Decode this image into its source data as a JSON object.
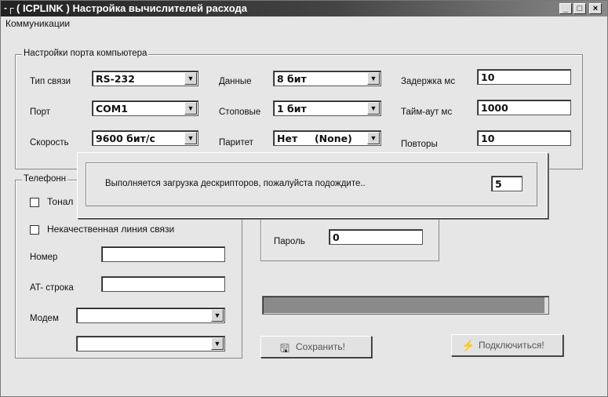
{
  "window": {
    "title": "( ICPLINK ) Настройка вычислителей расхода",
    "system_icon": "-┌",
    "min_glyph": "_",
    "max_glyph": "□",
    "close_glyph": "×"
  },
  "menu": {
    "items": [
      {
        "label": "Коммуникации"
      }
    ]
  },
  "port_settings": {
    "title": "Настройки порта компьютера",
    "conn_type": {
      "label": "Тип связи",
      "value": "RS-232"
    },
    "port": {
      "label": "Порт",
      "value": "COM1"
    },
    "speed": {
      "label": "Скорость",
      "value": "9600 бит/с"
    },
    "data_bits": {
      "label": "Данные",
      "value": "8 бит"
    },
    "stop_bits": {
      "label": "Стоповые",
      "value": "1 бит"
    },
    "parity": {
      "label": "Паритет",
      "value": "Нет     (None)"
    },
    "delay": {
      "label": "Задержка мс",
      "value": "10"
    },
    "timeout": {
      "label": "Тайм-аут мс",
      "value": "1000"
    },
    "retries": {
      "label": "Повторы",
      "value": "10"
    }
  },
  "phone": {
    "title": "Телефонн",
    "tone_label": "Тонал",
    "bad_line_label": "Некачественная линия связи",
    "number_label": "Номер",
    "number_value": "",
    "at_label": "AT- строка",
    "at_value": "",
    "modem_label": "Модем",
    "modem_value": "",
    "modem2_value": ""
  },
  "password": {
    "label": "Пароль",
    "value": "0"
  },
  "loading_dialog": {
    "message": "Выполняется загрузка дескрипторов, пожалуйста подождите..",
    "count": "5"
  },
  "progress": {
    "fraction": 0.99
  },
  "buttons": {
    "save": {
      "label": "Сохранить!",
      "icon": "floppy-disk-icon"
    },
    "connect": {
      "label": "Подключиться!",
      "icon": "plug-icon"
    }
  }
}
